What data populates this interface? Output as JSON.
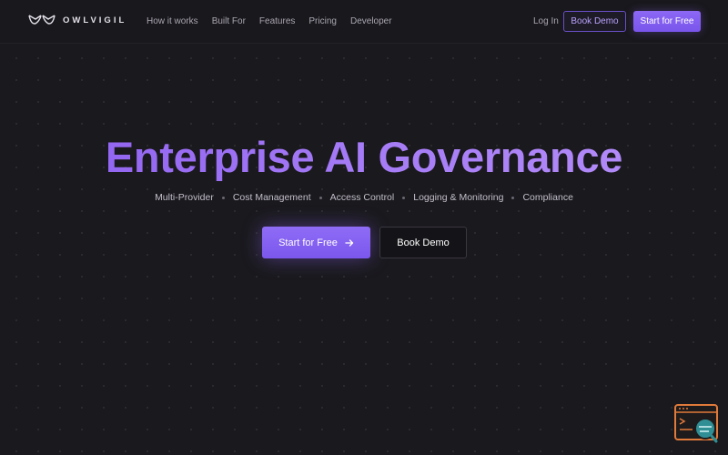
{
  "nav": {
    "brand": "OWLVIGIL",
    "links": [
      "How it works",
      "Built For",
      "Features",
      "Pricing",
      "Developer"
    ],
    "login": "Log In",
    "book_demo": "Book Demo",
    "start_free": "Start for Free"
  },
  "hero": {
    "title": "Enterprise AI Governance",
    "features": [
      "Multi-Provider",
      "Cost Management",
      "Access Control",
      "Logging & Monitoring",
      "Compliance"
    ],
    "start_free": "Start for Free",
    "book_demo": "Book Demo"
  },
  "colors": {
    "accent": "#8b66f4",
    "background": "#19181c",
    "widget_orange": "#e07a3a",
    "widget_teal": "#2f8f95"
  },
  "icons": {
    "logo": "owl-eyes-icon",
    "arrow": "arrow-right-icon",
    "widget": "chat-support-icon"
  }
}
